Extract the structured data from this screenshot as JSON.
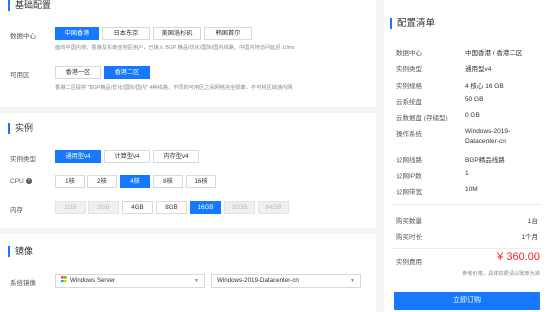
{
  "basic": {
    "title": "基础配置",
    "datacenter_label": "数据中心",
    "datacenters": [
      "中国香港",
      "日本东京",
      "美国洛杉矶",
      "韩国首尔"
    ],
    "datacenter_note": "面向中国内地、香港及东南亚地区用户，已接入 BGP 精品/优化/国际/国内线路，中国内地访问延迟 10ms",
    "zone_label": "可用区",
    "zones": [
      "香港一区",
      "香港二区"
    ],
    "zone_note": "香港二区提供 \"BGP精品/优化/国际/国内\" 4种线路，不同的可用区之间网络完全隔离，不可将区域通内网"
  },
  "instance": {
    "title": "实例",
    "type_label": "实例类型",
    "types": [
      "通用型v4",
      "计算型v4",
      "内存型v4"
    ],
    "cpu_label": "CPU",
    "cpus": [
      "1核",
      "2核",
      "4核",
      "8核",
      "16核"
    ],
    "mem_label": "内存",
    "mems": [
      "1GB",
      "2GB",
      "4GB",
      "8GB",
      "16GB",
      "32GB",
      "64GB"
    ]
  },
  "image": {
    "title": "镜像",
    "label": "系统镜像",
    "os": "Windows Server",
    "version": "Windows-2019-Datacenter-cn"
  },
  "summary": {
    "title": "配置清单",
    "rows": [
      {
        "k": "数据中心",
        "v": "中国香港 / 香港二区"
      },
      {
        "k": "实例类型",
        "v": "通用型v4"
      },
      {
        "k": "实例规格",
        "v": "4 核心 16 GB"
      },
      {
        "k": "云系统盘",
        "v": "50 GB"
      },
      {
        "k": "云数据盘 (存储型)",
        "v": "0 GB"
      },
      {
        "k": "操作系统",
        "v": "Windows-2019-"
      },
      {
        "k": "",
        "v": "Datacenter-cn"
      },
      {
        "k": "公网线路",
        "v": "BGP精品线路"
      },
      {
        "k": "公网IP数",
        "v": "1"
      },
      {
        "k": "公网带宽",
        "v": "10M"
      }
    ],
    "qty_label": "购买数量",
    "qty_value": "1台",
    "duration_label": "购买时长",
    "duration_value": "1个月",
    "fee_label": "实例费用",
    "fee_value": "¥ 360.00",
    "fee_note": "参考价格，具体扣费请以账单为准",
    "buy_label": "立即订购"
  },
  "colors": {
    "accent": "#1677ff",
    "price": "#f5222d",
    "bg": "#f3f4f6"
  }
}
